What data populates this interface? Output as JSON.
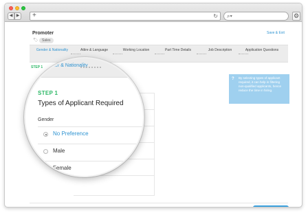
{
  "header": {
    "title": "Promoter",
    "tag": "Sales",
    "save_exit": "Save & Exit"
  },
  "steps": [
    {
      "label": "Gender & Nationality",
      "active": true
    },
    {
      "label": "Attire & Language",
      "active": false
    },
    {
      "label": "Working Location",
      "active": false
    },
    {
      "label": "Part Time Details",
      "active": false
    },
    {
      "label": "Job Description",
      "active": false
    },
    {
      "label": "Application Questions",
      "active": false
    }
  ],
  "form": {
    "step_label": "STEP 1",
    "title": "Types of Applicant Required",
    "gender_label": "Gender",
    "options": [
      {
        "label": "No Preference",
        "checked": true
      },
      {
        "label": "Male",
        "checked": false
      },
      {
        "label": "Female",
        "checked": false
      }
    ]
  },
  "tooltip": {
    "icon": "?",
    "text": "By selecting types of applicant required, it can help in filtering non-qualified applicants, hence reduce the time in hiring."
  },
  "colors": {
    "accent": "#2e93d1",
    "step_green": "#2cb866",
    "tooltip_bg": "#9fd0ef"
  }
}
